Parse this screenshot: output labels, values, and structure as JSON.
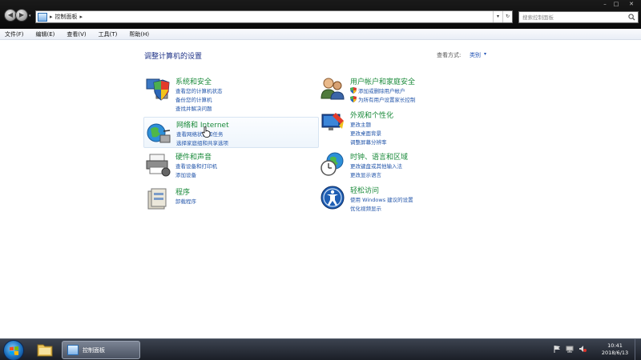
{
  "address": {
    "separator": "▸",
    "path": "控制面板",
    "separator_end": "▸",
    "dropdown_glyph": "▾",
    "refresh_glyph": "↻"
  },
  "window_controls": {
    "min": "–",
    "max": "□",
    "close": "✕"
  },
  "search": {
    "placeholder": "搜索控制面板"
  },
  "menu": [
    "文件(F)",
    "编辑(E)",
    "查看(V)",
    "工具(T)",
    "帮助(H)"
  ],
  "page": {
    "title": "调整计算机的设置",
    "view_by_label": "查看方式:",
    "view_by_value": "类别",
    "view_by_arrow": "▾"
  },
  "categories": [
    {
      "id": "system-security",
      "title": "系统和安全",
      "icon": "shield-computer-icon",
      "links": [
        "查看您的计算机状态",
        "备份您的计算机",
        "查找并解决问题"
      ]
    },
    {
      "id": "network-internet",
      "title": "网络和 Internet",
      "icon": "globe-network-icon",
      "links": [
        "查看网络状态和任务",
        "选择家庭组和共享选项"
      ],
      "hovered": true
    },
    {
      "id": "hardware-sound",
      "title": "硬件和声音",
      "icon": "printer-icon",
      "links": [
        "查看设备和打印机",
        "添加设备"
      ]
    },
    {
      "id": "programs",
      "title": "程序",
      "icon": "programs-icon",
      "links": [
        "卸载程序"
      ]
    },
    {
      "id": "user-accounts",
      "title": "用户帐户和家庭安全",
      "icon": "users-icon",
      "links": [
        "添加或删除用户帐户",
        "为所有用户设置家长控制"
      ],
      "link_icons": [
        "shield-icon",
        "shield-icon"
      ]
    },
    {
      "id": "appearance",
      "title": "外观和个性化",
      "icon": "monitor-paint-icon",
      "links": [
        "更改主题",
        "更改桌面背景",
        "调整屏幕分辨率"
      ]
    },
    {
      "id": "clock-region",
      "title": "时钟、语言和区域",
      "icon": "clock-globe-icon",
      "links": [
        "更改键盘或其他输入法",
        "更改显示语言"
      ]
    },
    {
      "id": "ease-of-access",
      "title": "轻松访问",
      "icon": "accessibility-icon",
      "links": [
        "使用 Windows 建议的设置",
        "优化视频显示"
      ]
    }
  ],
  "taskbar": {
    "active_window": "控制面板",
    "time": "10:41",
    "date": "2018/6/13"
  },
  "colors": {
    "link": "#2255aa",
    "category_title": "#1a8a3a",
    "page_title": "#1e3287",
    "hover_bg": "#eef5fc"
  }
}
